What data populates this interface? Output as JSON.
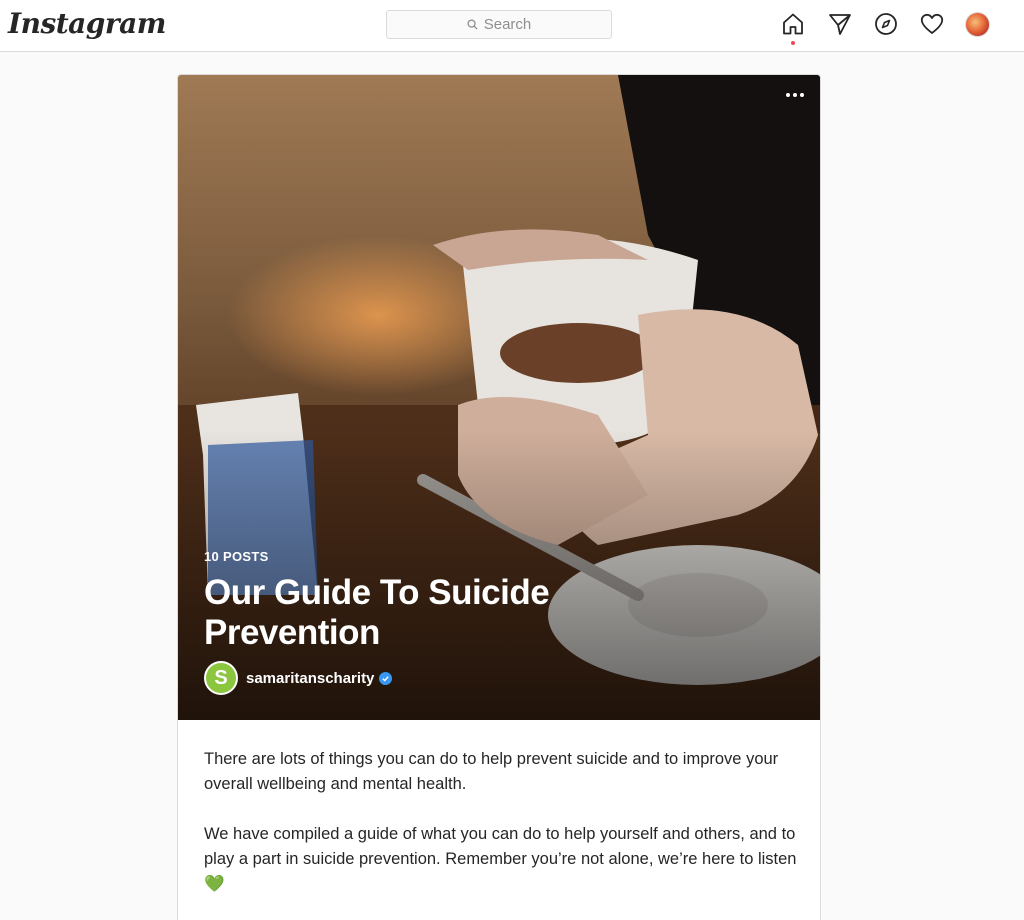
{
  "header": {
    "logo": "Instagram",
    "search_placeholder": "Search",
    "icons": [
      "home-icon",
      "direct-message-icon",
      "explore-compass-icon",
      "activity-heart-icon",
      "profile-avatar"
    ]
  },
  "guide": {
    "post_count": "10 POSTS",
    "title": "Our Guide To Suicide Prevention",
    "author": "samaritanscharity",
    "author_initial": "S",
    "description": [
      "There are lots of things you can do to help prevent suicide and to improve your overall wellbeing and mental health.",
      "We have compiled a guide of what you can do to help yourself and others, and to play a part in suicide prevention. Remember you’re not alone, we’re here to listen 💚"
    ]
  },
  "colors": {
    "notification_dot": "#ed4956",
    "verified_badge": "#3897f0",
    "author_avatar": "#8cc63f"
  }
}
